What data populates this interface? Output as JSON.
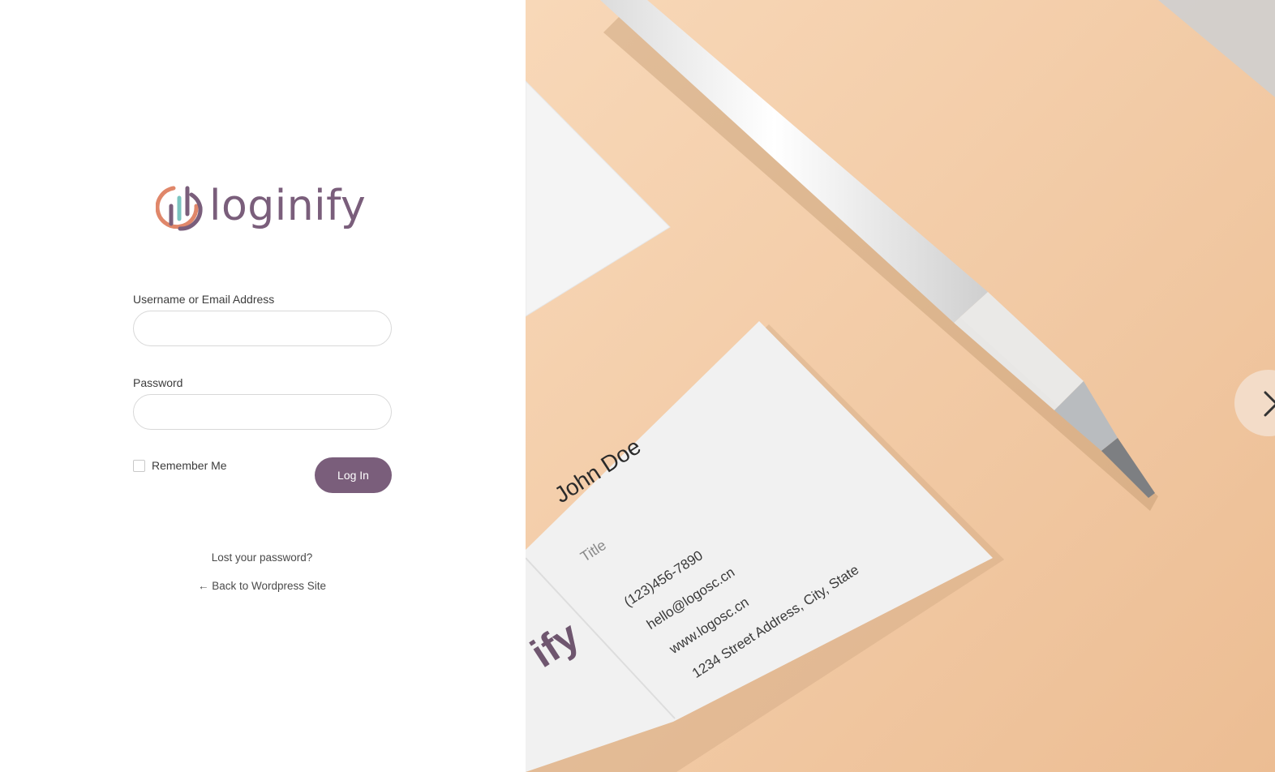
{
  "brand": {
    "name": "loginify",
    "color": "#7a5e7b",
    "accent": "#e0876a",
    "accent2": "#7ac4c0"
  },
  "form": {
    "username_label": "Username or Email Address",
    "username_value": "",
    "password_label": "Password",
    "password_value": "",
    "remember_label": "Remember Me",
    "remember_checked": false,
    "submit_label": "Log In"
  },
  "links": {
    "lost_password": "Lost your password?",
    "back_to_site": "← Back to Wordpress Site"
  },
  "hero": {
    "card_name": "John Doe",
    "card_title": "Title",
    "card_phone": "(123)456-7890",
    "card_email": "hello@logosc.cn",
    "card_web": "www.logosc.cn",
    "card_address": "1234 Street Address, City, State",
    "card_logo_fragment": "ify",
    "next_icon": "chevron-right-icon"
  }
}
